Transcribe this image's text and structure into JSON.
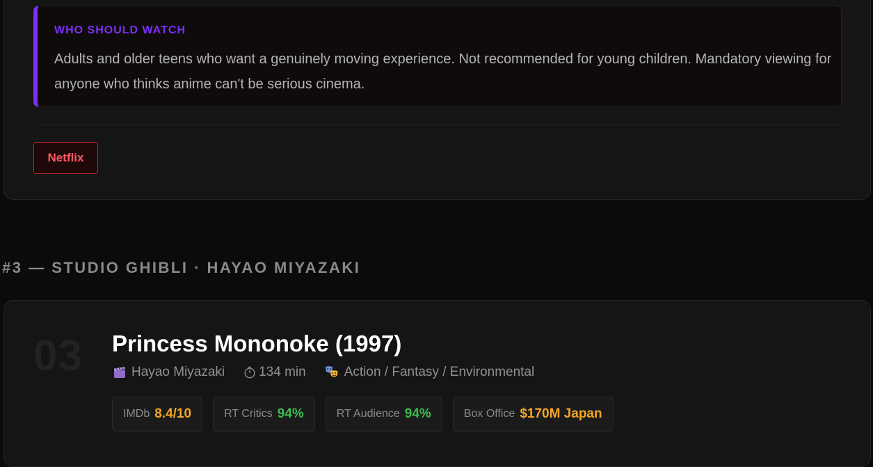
{
  "previous_entry": {
    "who_should_watch": {
      "title": "WHO SHOULD WATCH",
      "text": "Adults and older teens who want a genuinely moving experience. Not recommended for young children. Mandatory viewing for anyone who thinks anime can't be serious cinema."
    },
    "streaming": [
      "Netflix"
    ]
  },
  "section": {
    "heading": "#3 — STUDIO GHIBLI · HAYAO MIYAZAKI"
  },
  "entry": {
    "rank": "03",
    "title": "Princess Mononoke (1997)",
    "meta": {
      "director": "Hayao Miyazaki",
      "director_icon": "clapperboard-icon",
      "runtime": "134 min",
      "runtime_icon": "stopwatch-icon",
      "genre": "Action / Fantasy / Environmental",
      "genre_icon": "theater-masks-icon"
    },
    "stats": [
      {
        "label": "IMDb",
        "value": "8.4/10",
        "color": "#f5a623"
      },
      {
        "label": "RT Critics",
        "value": "94%",
        "color": "#3dbb4e"
      },
      {
        "label": "RT Audience",
        "value": "94%",
        "color": "#3dbb4e"
      },
      {
        "label": "Box Office",
        "value": "$170M Japan",
        "color": "#f5a623"
      }
    ]
  },
  "colors": {
    "accent_purple": "#7b2ff7",
    "netflix_red": "#ff5a63",
    "rating_orange": "#f5a623",
    "rating_green": "#3dbb4e"
  }
}
